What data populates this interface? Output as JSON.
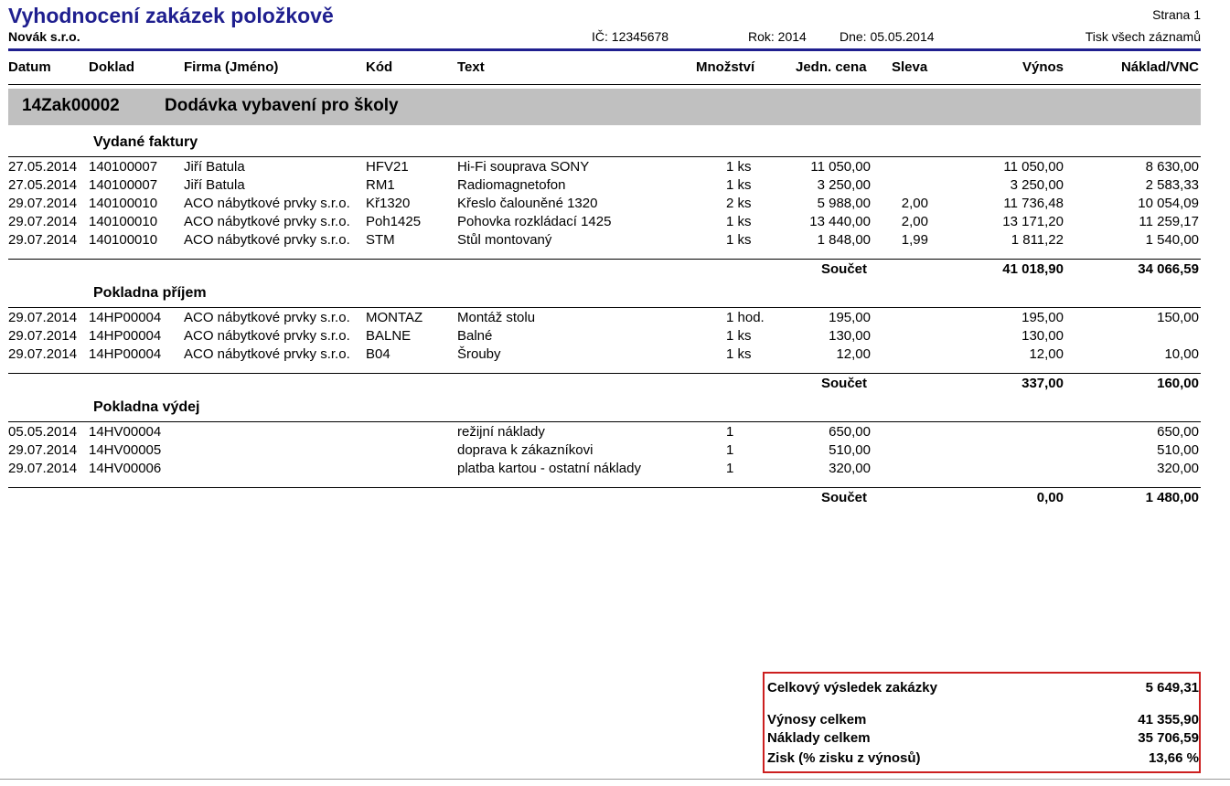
{
  "header": {
    "title": "Vyhodnocení zakázek položkově",
    "company": "Novák s.r.o.",
    "ic": "IČ: 12345678",
    "year": "Rok: 2014",
    "date": "Dne: 05.05.2014",
    "page": "Strana 1",
    "print_mode": "Tisk všech záznamů"
  },
  "columns": {
    "datum": "Datum",
    "doklad": "Doklad",
    "firma": "Firma (Jméno)",
    "kod": "Kód",
    "text": "Text",
    "mnozstvi": "Množství",
    "jedn_cena": "Jedn. cena",
    "sleva": "Sleva",
    "vynos": "Výnos",
    "naklad": "Náklad/VNC"
  },
  "order": {
    "code": "14Zak00002",
    "name": "Dodávka vybavení pro školy"
  },
  "sections": [
    {
      "title": "Vydané faktury",
      "rows": [
        {
          "datum": "27.05.2014",
          "doklad": "140100007",
          "firma": "Jiří Batula",
          "kod": "HFV21",
          "text": "Hi-Fi souprava SONY",
          "mnozstvi": "1 ks",
          "cena": "11 050,00",
          "sleva": "",
          "vynos": "11 050,00",
          "naklad": "8 630,00"
        },
        {
          "datum": "27.05.2014",
          "doklad": "140100007",
          "firma": "Jiří Batula",
          "kod": "RM1",
          "text": "Radiomagnetofon",
          "mnozstvi": "1 ks",
          "cena": "3 250,00",
          "sleva": "",
          "vynos": "3 250,00",
          "naklad": "2 583,33"
        },
        {
          "datum": "29.07.2014",
          "doklad": "140100010",
          "firma": "ACO nábytkové prvky s.r.o.",
          "kod": "Kř1320",
          "text": "Křeslo čalouněné 1320",
          "mnozstvi": "2 ks",
          "cena": "5 988,00",
          "sleva": "2,00",
          "vynos": "11 736,48",
          "naklad": "10 054,09"
        },
        {
          "datum": "29.07.2014",
          "doklad": "140100010",
          "firma": "ACO nábytkové prvky s.r.o.",
          "kod": "Poh1425",
          "text": "Pohovka rozkládací 1425",
          "mnozstvi": "1 ks",
          "cena": "13 440,00",
          "sleva": "2,00",
          "vynos": "13 171,20",
          "naklad": "11 259,17"
        },
        {
          "datum": "29.07.2014",
          "doklad": "140100010",
          "firma": "ACO nábytkové prvky s.r.o.",
          "kod": "STM",
          "text": "Stůl montovaný",
          "mnozstvi": "1 ks",
          "cena": "1 848,00",
          "sleva": "1,99",
          "vynos": "1 811,22",
          "naklad": "1 540,00"
        }
      ],
      "total": {
        "label": "Součet",
        "vynos": "41 018,90",
        "naklad": "34 066,59"
      }
    },
    {
      "title": "Pokladna příjem",
      "rows": [
        {
          "datum": "29.07.2014",
          "doklad": "14HP00004",
          "firma": "ACO nábytkové prvky s.r.o.",
          "kod": "MONTAZ",
          "text": "Montáž stolu",
          "mnozstvi": "1 hod.",
          "cena": "195,00",
          "sleva": "",
          "vynos": "195,00",
          "naklad": "150,00"
        },
        {
          "datum": "29.07.2014",
          "doklad": "14HP00004",
          "firma": "ACO nábytkové prvky s.r.o.",
          "kod": "BALNE",
          "text": "Balné",
          "mnozstvi": "1 ks",
          "cena": "130,00",
          "sleva": "",
          "vynos": "130,00",
          "naklad": ""
        },
        {
          "datum": "29.07.2014",
          "doklad": "14HP00004",
          "firma": "ACO nábytkové prvky s.r.o.",
          "kod": "B04",
          "text": "Šrouby",
          "mnozstvi": "1 ks",
          "cena": "12,00",
          "sleva": "",
          "vynos": "12,00",
          "naklad": "10,00"
        }
      ],
      "total": {
        "label": "Součet",
        "vynos": "337,00",
        "naklad": "160,00"
      }
    },
    {
      "title": "Pokladna výdej",
      "rows": [
        {
          "datum": "05.05.2014",
          "doklad": "14HV00004",
          "firma": "",
          "kod": "",
          "text": "režijní náklady",
          "mnozstvi": "1",
          "cena": "650,00",
          "sleva": "",
          "vynos": "",
          "naklad": "650,00"
        },
        {
          "datum": "29.07.2014",
          "doklad": "14HV00005",
          "firma": "",
          "kod": "",
          "text": "doprava k zákazníkovi",
          "mnozstvi": "1",
          "cena": "510,00",
          "sleva": "",
          "vynos": "",
          "naklad": "510,00"
        },
        {
          "datum": "29.07.2014",
          "doklad": "14HV00006",
          "firma": "",
          "kod": "",
          "text": "platba kartou - ostatní náklady",
          "mnozstvi": "1",
          "cena": "320,00",
          "sleva": "",
          "vynos": "",
          "naklad": "320,00"
        }
      ],
      "total": {
        "label": "Součet",
        "vynos": "0,00",
        "naklad": "1 480,00"
      }
    }
  ],
  "summary": {
    "result_label": "Celkový výsledek zakázky",
    "result_value": "5 649,31",
    "revenue_label": "Výnosy celkem",
    "revenue_value": "41 355,90",
    "costs_label": "Náklady celkem",
    "costs_value": "35 706,59",
    "profit_label": "Zisk (% zisku z výnosů)",
    "profit_value": "13,66 %"
  }
}
